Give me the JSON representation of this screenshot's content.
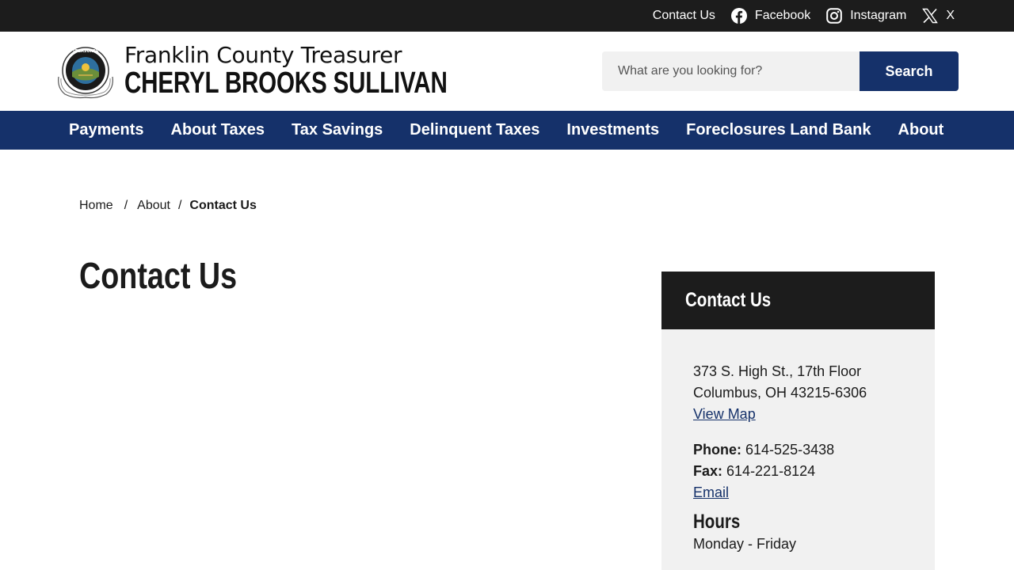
{
  "topbar": {
    "links": [
      {
        "label": "Contact Us",
        "icon": ""
      },
      {
        "label": "Facebook",
        "icon": "facebook-icon"
      },
      {
        "label": "Instagram",
        "icon": "instagram-icon"
      },
      {
        "label": "X",
        "icon": "x-icon"
      }
    ]
  },
  "header": {
    "seal_icon": "county-seal-icon",
    "org_name": "Franklin County Treasurer",
    "person_name": "CHERYL BROOKS SULLIVAN",
    "search": {
      "placeholder": "What are you looking for?",
      "button_label": "Search"
    }
  },
  "nav": {
    "items": [
      "Payments",
      "About Taxes",
      "Tax Savings",
      "Delinquent Taxes",
      "Investments",
      "Foreclosures Land Bank",
      "About"
    ]
  },
  "breadcrumb": {
    "items": [
      "Home",
      "About",
      "Contact Us"
    ],
    "separator": "/"
  },
  "page": {
    "title": "Contact Us"
  },
  "sidebar": {
    "title": "Contact Us",
    "address_line1": "373 S. High St., 17th Floor",
    "address_line2": "Columbus, OH 43215-6306",
    "map_link": "View Map",
    "phone_label": "Phone:",
    "phone_value": "614-525-3438",
    "fax_label": "Fax:",
    "fax_value": "614-221-8124",
    "email_link": "Email",
    "hours_title": "Hours",
    "hours_days": "Monday - Friday"
  },
  "colors": {
    "topbar_bg": "#1c1c1c",
    "brand_navy": "#15316a",
    "card_bg": "#f1f1f1"
  }
}
